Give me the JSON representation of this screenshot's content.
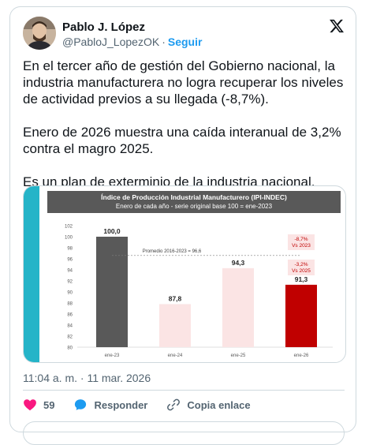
{
  "author": {
    "name": "Pablo J. López",
    "handle": "@PabloJ_LopezOK",
    "separator": "·",
    "follow_label": "Seguir"
  },
  "tweet": {
    "paragraphs": [
      "En el tercer año de gestión del Gobierno nacional, la industria manufacturera no logra recuperar los niveles de actividad previos a su llegada (-8,7%).",
      "Enero de 2026 muestra una caída interanual de 3,2% contra el magro 2025.",
      "Es un plan de exterminio de la industria nacional."
    ],
    "timestamp": "11:04 a. m. · 11 mar. 2026"
  },
  "actions": {
    "likes": "59",
    "reply_label": "Responder",
    "copy_label": "Copia enlace"
  },
  "icons": {
    "brand": "x-logo-icon",
    "like": "heart-icon",
    "reply": "reply-bubble-icon",
    "copy": "link-icon"
  },
  "colors": {
    "accent": "#1d9bf0",
    "like": "#f91880",
    "teal": "#25b4c8",
    "bar_dark": "#595959",
    "bar_light": "#fbe4e4",
    "bar_red": "#c00000",
    "annot_bg": "#fbe4e4",
    "annot_text": "#c00000"
  },
  "chart_data": {
    "type": "bar",
    "title": "Índice de Producción Industrial Manufacturero (IPI-INDEC)",
    "subtitle": "Enero de cada año - serie original base 100 = ene-2023",
    "categories": [
      "ene-23",
      "ene-24",
      "ene-25",
      "ene-26"
    ],
    "values": [
      100.0,
      87.8,
      94.3,
      91.3
    ],
    "value_labels": [
      "100,0",
      "87,8",
      "94,3",
      "91,3"
    ],
    "bar_colors": [
      "#595959",
      "#fbe4e4",
      "#fbe4e4",
      "#c00000"
    ],
    "ylim": [
      80,
      102
    ],
    "yticks": [
      80,
      82,
      84,
      86,
      88,
      90,
      92,
      94,
      96,
      98,
      100,
      102
    ],
    "average": {
      "label": "Promedio 2016-2023 = 96,6",
      "value": 96.6
    },
    "annotations": [
      {
        "lines": [
          "-8,7%",
          "Vs 2023"
        ]
      },
      {
        "lines": [
          "-3,2%",
          "Vs 2025"
        ]
      }
    ],
    "grid": false,
    "legend": "none"
  }
}
